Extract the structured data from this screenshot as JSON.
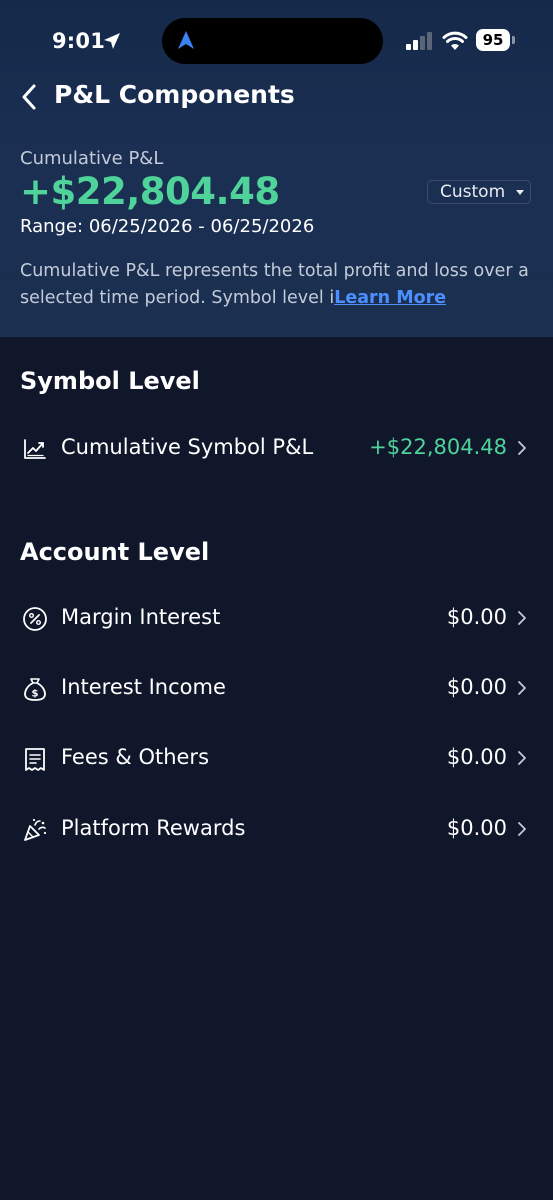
{
  "status_bar": {
    "time": "9:01",
    "battery": "95"
  },
  "nav": {
    "title": "P&L Components"
  },
  "summary": {
    "label": "Cumulative P&L",
    "value": "+$22,804.48",
    "range_selector": "Custom",
    "range": "Range: 06/25/2026 - 06/25/2026",
    "description": "Cumulative P&L represents the total profit and loss over a selected time period. Symbol level i",
    "learn_more": "Learn More"
  },
  "symbol_level": {
    "title": "Symbol Level",
    "items": [
      {
        "label": "Cumulative Symbol P&L",
        "value": "+$22,804.48",
        "icon": "trend-chart-icon"
      }
    ]
  },
  "account_level": {
    "title": "Account Level",
    "items": [
      {
        "label": "Margin Interest",
        "value": "$0.00",
        "icon": "percent-icon"
      },
      {
        "label": "Interest Income",
        "value": "$0.00",
        "icon": "money-bag-icon"
      },
      {
        "label": "Fees & Others",
        "value": "$0.00",
        "icon": "receipt-icon"
      },
      {
        "label": "Platform Rewards",
        "value": "$0.00",
        "icon": "party-popper-icon"
      }
    ]
  },
  "colors": {
    "background": "#10172b",
    "header_gradient": "#1a2f52",
    "positive": "#4fd39a",
    "link": "#4c8fff"
  }
}
